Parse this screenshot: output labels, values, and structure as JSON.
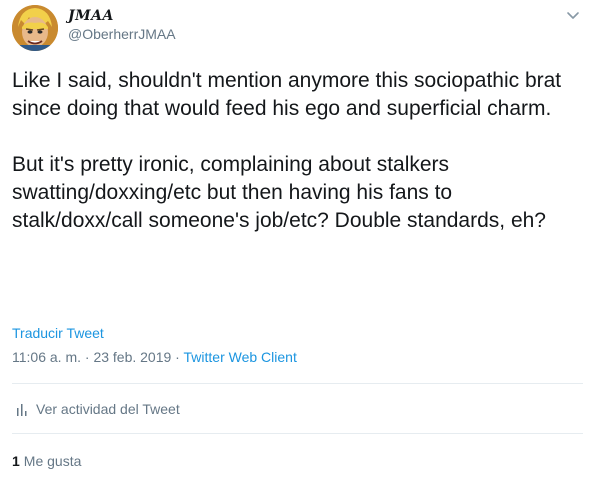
{
  "author": {
    "display_name": "JMAA",
    "handle": "@OberherrJMAA",
    "avatar_icon": "cartoon-avatar"
  },
  "tweet": {
    "paragraphs": [
      "Like I said, shouldn't mention anymore this sociopathic brat since doing that would feed his ego and superficial charm.",
      "But it's pretty ironic, complaining about stalkers swatting/doxxing/etc but then having his fans to stalk/doxx/call someone's job/etc? Double standards, eh?"
    ],
    "translate_label": "Traducir Tweet",
    "timestamp": "11:06 a. m. · 23 feb. 2019",
    "separator": " · ",
    "client": "Twitter Web Client"
  },
  "activity": {
    "label": "Ver actividad del Tweet",
    "icon": "bar-chart-icon"
  },
  "stats": {
    "likes_count": "1",
    "likes_label": "Me gusta"
  },
  "colors": {
    "text": "#14171a",
    "secondary": "#657786",
    "link": "#1b95e0",
    "divider": "#e6ecf0"
  }
}
